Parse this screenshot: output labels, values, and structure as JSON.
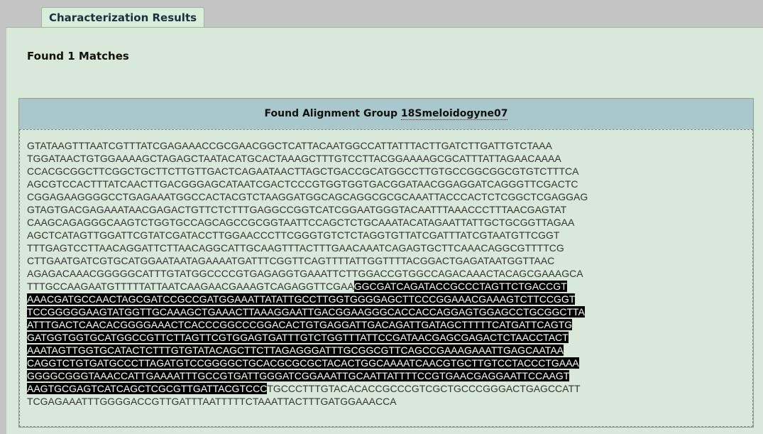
{
  "tab": {
    "label": "Characterization Results"
  },
  "results": {
    "found_text": "Found 1 Matches"
  },
  "group": {
    "header_prefix": "Found Alignment Group",
    "header_link": "18Smeloidogyne07"
  },
  "sequence": {
    "lines": [
      {
        "pre": "GTATAAGTTTAATCGTTTATCGAGAAACCGCGAACGGCTCATTACAATGGCCATTATTTACTTGATCTTGATTGTCTAAA",
        "hl": "",
        "post": ""
      },
      {
        "pre": "TGGATAACTGTGGAAAAGCTAGAGCTAATACATGCACTAAAGCTTTGTCCTTACGGAAAAGCGCATTTATTAGAACAAAA",
        "hl": "",
        "post": ""
      },
      {
        "pre": "CCACGCGGCTTCGGCTGCTTCTTGTTGACTCAGAATAACTTAGCTGACCGCATGGCCTTGTGCCGGCGGCGTGTCTTTCA",
        "hl": "",
        "post": ""
      },
      {
        "pre": "AGCGTCCACTTTATCAACTTGACGGGAGCATAATCGACTCCCGTGGTGGTGACGGATAACGGAGGATCAGGGTTCGACTC",
        "hl": "",
        "post": ""
      },
      {
        "pre": "CGGAGAAGGGGCCTGAGAAATGGCCACTACGTCTAAGGATGGCAGCAGGCGCGCAAATTACCCACTCTCGGCTCGAGGAG",
        "hl": "",
        "post": ""
      },
      {
        "pre": "GTAGTGACGAGAAATAACGAGACTGTTCTCTTTGAGGCCGGTCATCGGAATGGGTACAATTTAAACCCTTTAACGAGTAT",
        "hl": "",
        "post": ""
      },
      {
        "pre": "CAAGCAGAGGGCAAGTCTGGTGCCAGCAGCCGCGGTAATTCCAGCTCTGCAAATACATAGAATTATTGCTGCGGTTAGAA",
        "hl": "",
        "post": ""
      },
      {
        "pre": "AGCTCATAGTTGGATTCGTATCGATACCTTGGAACCCTTCGGGTGTCTCTAGGTGTTATCGATTTATCGTAATGTTCGGT",
        "hl": "",
        "post": ""
      },
      {
        "pre": "TTTGAGTCCTTAACAGGATTCTTAACAGGCATTGCAAGTTTACTTTGAACAAATCAGAGTGCTTCAAACAGGCGTTTTCG",
        "hl": "",
        "post": ""
      },
      {
        "pre": "CTTGAATGATCGTGCATGGAATAATAGAAAATGATTTCGGTTCAGTTTTATTGGTTTTACGGACTGAGATAATGGTTAAC",
        "hl": "",
        "post": ""
      },
      {
        "pre": "AGAGACAAACGGGGGCATTTGTATGGCCCCGTGAGAGGTGAAATTCTTGGACCGTGGCCAGACAAACTACAGCGAAAGCA",
        "hl": "",
        "post": ""
      },
      {
        "pre": "TTTGCCAAGAATGTTTTTATTAATCAAGAACGAAAGTCAGAGGTTCGAA",
        "hl": "GGCGATCAGATACCGCCCTAGTTCTGACCGT",
        "post": ""
      },
      {
        "pre": "",
        "hl": "AAACGATGCCAACTAGCGATCCGCCGATGGAAATTATATTGCCTTGGTGGGGAGCTTCCCGGAAACGAAAGTCTTCCGGT",
        "post": ""
      },
      {
        "pre": "",
        "hl": "TCCGGGGGAAGTATGGTTGCAAAGCTGAAACTTAAAGGAATTGACGGAAGGGCACCACCAGGAGTGGAGCCTGCGGCTTA",
        "post": ""
      },
      {
        "pre": "",
        "hl": "ATTTGACTCAACACGGGGAAACTCACCCGGCCCGGACACTGTGAGGATTGACAGATTGATAGCTTTTTCATGATTCAGTG",
        "post": ""
      },
      {
        "pre": "",
        "hl": "GATGGTGGTGCATGGCCGTTCTTAGTTCGTGGAGTGATTTGTCTGGTTTATTCCGATAACGAGCGAGACTCTAACCTACT",
        "post": ""
      },
      {
        "pre": "",
        "hl": "AAATAGTTGGTGCATACTCTTTGTGTATACAGCTTCTTAGAGGGATTTGCGGCGTTCAGCCGAAAGAAATTGAGCAATAA",
        "post": ""
      },
      {
        "pre": "",
        "hl": "CAGGTCTGTGATGCCCTTAGATGTCCGGGGCTGCACGCGCGCTACACTGGCAAAATCAACGTGCTTGTCCTACCCTGAAA",
        "post": ""
      },
      {
        "pre": "",
        "hl": "GGGGCGGGTAAACCATTGAAAATTTGCCGTGATTGGGATCGGAAATTGCAATTATTTTCCGTGAACGAGGAATTCCAAGT",
        "post": ""
      },
      {
        "pre": "",
        "hl": "AAGTGCGAGTCATCAGCTCGCGTTGATTACGTCCC",
        "post": "TGCCCTTTGTACACACCGCCCGTCGCTGCCCGGGACTGAGCCATT"
      },
      {
        "pre": "TCGAGAAATTTGGGGACCGTTGATTTAATTTTTCTAAATTACTTTGATGGAAACCA",
        "hl": "",
        "post": ""
      }
    ]
  }
}
